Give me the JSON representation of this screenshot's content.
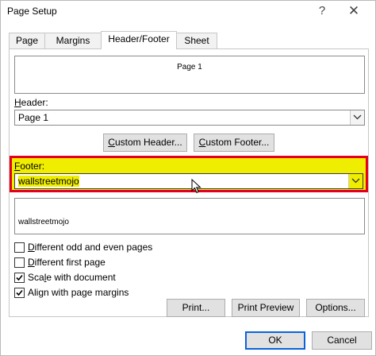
{
  "window": {
    "title": "Page Setup",
    "help_glyph": "?",
    "close_glyph": "✕"
  },
  "tabs": [
    {
      "label": "Page",
      "active": false
    },
    {
      "label": "Margins",
      "active": false
    },
    {
      "label": "Header/Footer",
      "active": true
    },
    {
      "label": "Sheet",
      "active": false
    }
  ],
  "header": {
    "preview_text": "Page 1",
    "label_prefix": "H",
    "label_rest": "eader:",
    "value": "Page 1"
  },
  "custom_header_button": {
    "label_prefix": "C",
    "label_rest": "ustom Header..."
  },
  "custom_footer_button": {
    "label_prefix": "C",
    "label_rest": "ustom Footer..."
  },
  "footer": {
    "label_prefix": "F",
    "label_rest": "ooter:",
    "value": "wallstreetmojo",
    "preview_text": "wallstreetmojo",
    "highlight_color": "#f0ee00",
    "highlight_border": "#e4001b"
  },
  "options": [
    {
      "prefix": "D",
      "rest": "ifferent odd and even pages",
      "checked": false
    },
    {
      "prefix": "D",
      "rest": "ifferent first page",
      "checked": false
    },
    {
      "prefix": "",
      "rest": "Scale with document",
      "underline_index": 3,
      "checked": true
    },
    {
      "prefix": "",
      "rest": "Align with page margins",
      "checked": true
    }
  ],
  "action_buttons": {
    "print": "Print...",
    "print_preview": "Print Preview",
    "options": "Options..."
  },
  "dialog_buttons": {
    "ok": "OK",
    "cancel": "Cancel"
  },
  "colors": {
    "accent": "#0a64d8"
  }
}
